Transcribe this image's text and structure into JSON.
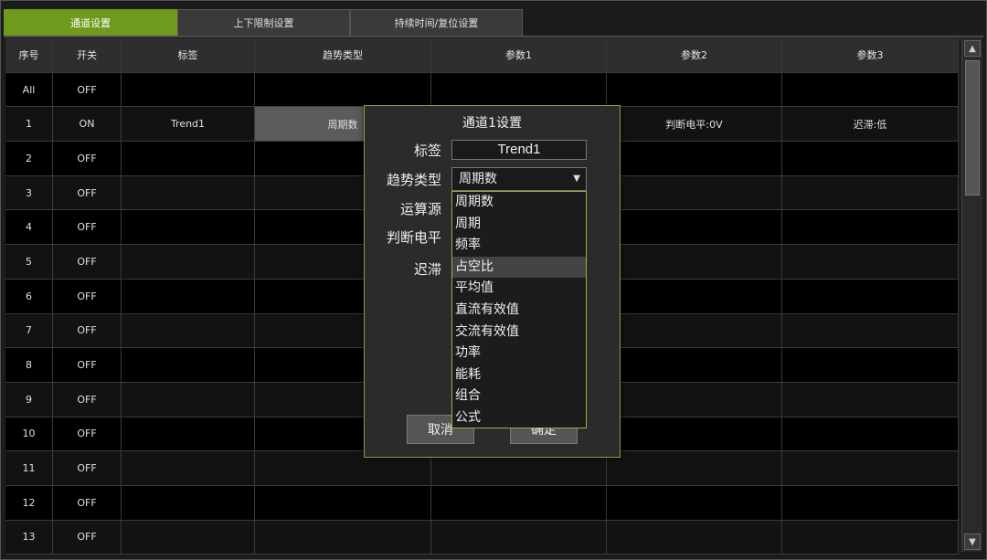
{
  "tabs": [
    "通道设置",
    "上下限制设置",
    "持续时间/复位设置"
  ],
  "table": {
    "headers": [
      "序号",
      "开关",
      "标签",
      "趋势类型",
      "参数1",
      "参数2",
      "参数3"
    ],
    "rows": [
      [
        "All",
        "OFF",
        "",
        "",
        "",
        "",
        ""
      ],
      [
        "1",
        "ON",
        "Trend1",
        "周期数",
        "",
        "判断电平:0V",
        "迟滞:低"
      ],
      [
        "2",
        "OFF",
        "",
        "",
        "",
        "",
        ""
      ],
      [
        "3",
        "OFF",
        "",
        "",
        "",
        "",
        ""
      ],
      [
        "4",
        "OFF",
        "",
        "",
        "",
        "",
        ""
      ],
      [
        "5",
        "OFF",
        "",
        "",
        "",
        "",
        ""
      ],
      [
        "6",
        "OFF",
        "",
        "",
        "",
        "",
        ""
      ],
      [
        "7",
        "OFF",
        "",
        "",
        "",
        "",
        ""
      ],
      [
        "8",
        "OFF",
        "",
        "",
        "",
        "",
        ""
      ],
      [
        "9",
        "OFF",
        "",
        "",
        "",
        "",
        ""
      ],
      [
        "10",
        "OFF",
        "",
        "",
        "",
        "",
        ""
      ],
      [
        "11",
        "OFF",
        "",
        "",
        "",
        "",
        ""
      ],
      [
        "12",
        "OFF",
        "",
        "",
        "",
        "",
        ""
      ],
      [
        "13",
        "OFF",
        "",
        "",
        "",
        "",
        ""
      ]
    ]
  },
  "scrollbar": {
    "up_icon": "chevron-up-icon",
    "down_icon": "chevron-down-icon"
  },
  "dialog": {
    "title": "通道1设置",
    "label_label": "标签",
    "label_value": "Trend1",
    "trend_type_label": "趋势类型",
    "trend_type_value": "周期数",
    "source_label": "运算源",
    "level_label": "判断电平",
    "hysteresis_label": "迟滞",
    "cancel_label": "取消",
    "ok_label": "确定",
    "options": [
      "周期数",
      "周期",
      "频率",
      "占空比",
      "平均值",
      "直流有效值",
      "交流有效值",
      "功率",
      "能耗",
      "组合",
      "公式"
    ],
    "hovered_option": "占空比"
  },
  "colors": {
    "accent": "#6f9a1d",
    "dialog_border": "#7da52a",
    "background": "#1c1c1c"
  }
}
